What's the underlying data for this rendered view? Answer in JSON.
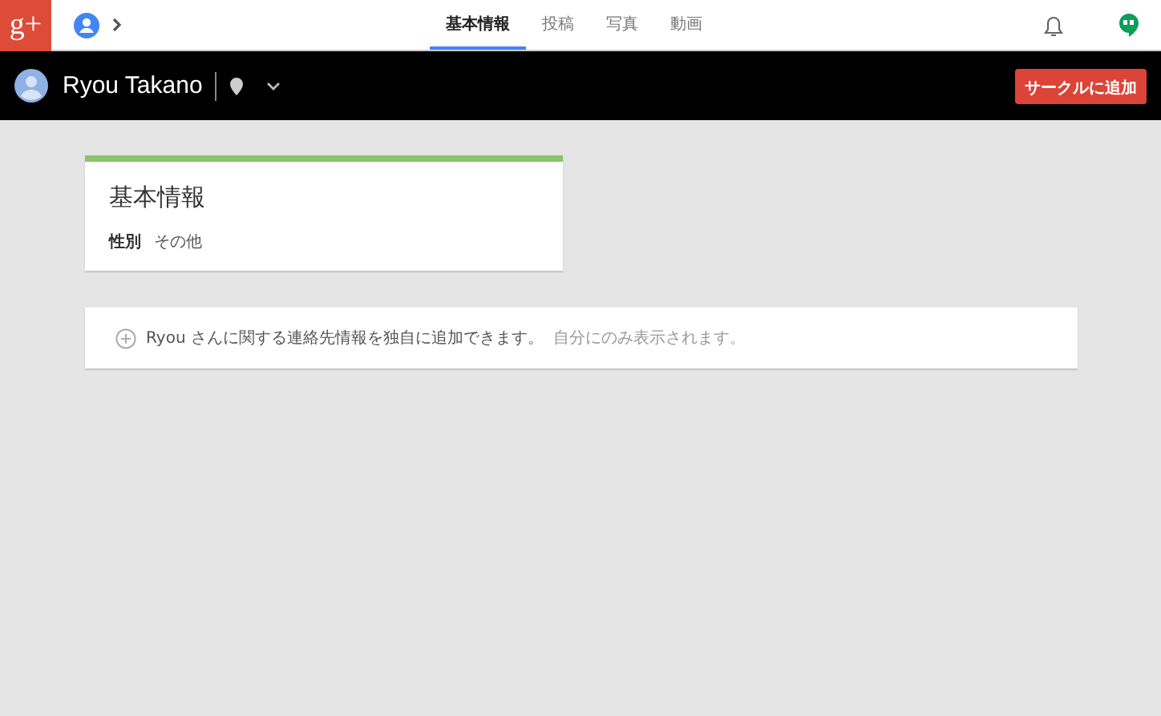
{
  "logo": {
    "text": "g+"
  },
  "tabs": [
    {
      "label": "基本情報",
      "selected": true
    },
    {
      "label": "投稿",
      "selected": false
    },
    {
      "label": "写真",
      "selected": false
    },
    {
      "label": "動画",
      "selected": false
    }
  ],
  "profile": {
    "name": "Ryou Takano"
  },
  "add_button": {
    "label": "サークルに追加"
  },
  "about_card": {
    "title": "基本情報",
    "fields": [
      {
        "label": "性別",
        "value": "その他"
      }
    ]
  },
  "contact_card": {
    "text": "Ryou さんに関する連絡先情報を独自に追加できます。",
    "note": "自分にのみ表示されます。"
  }
}
